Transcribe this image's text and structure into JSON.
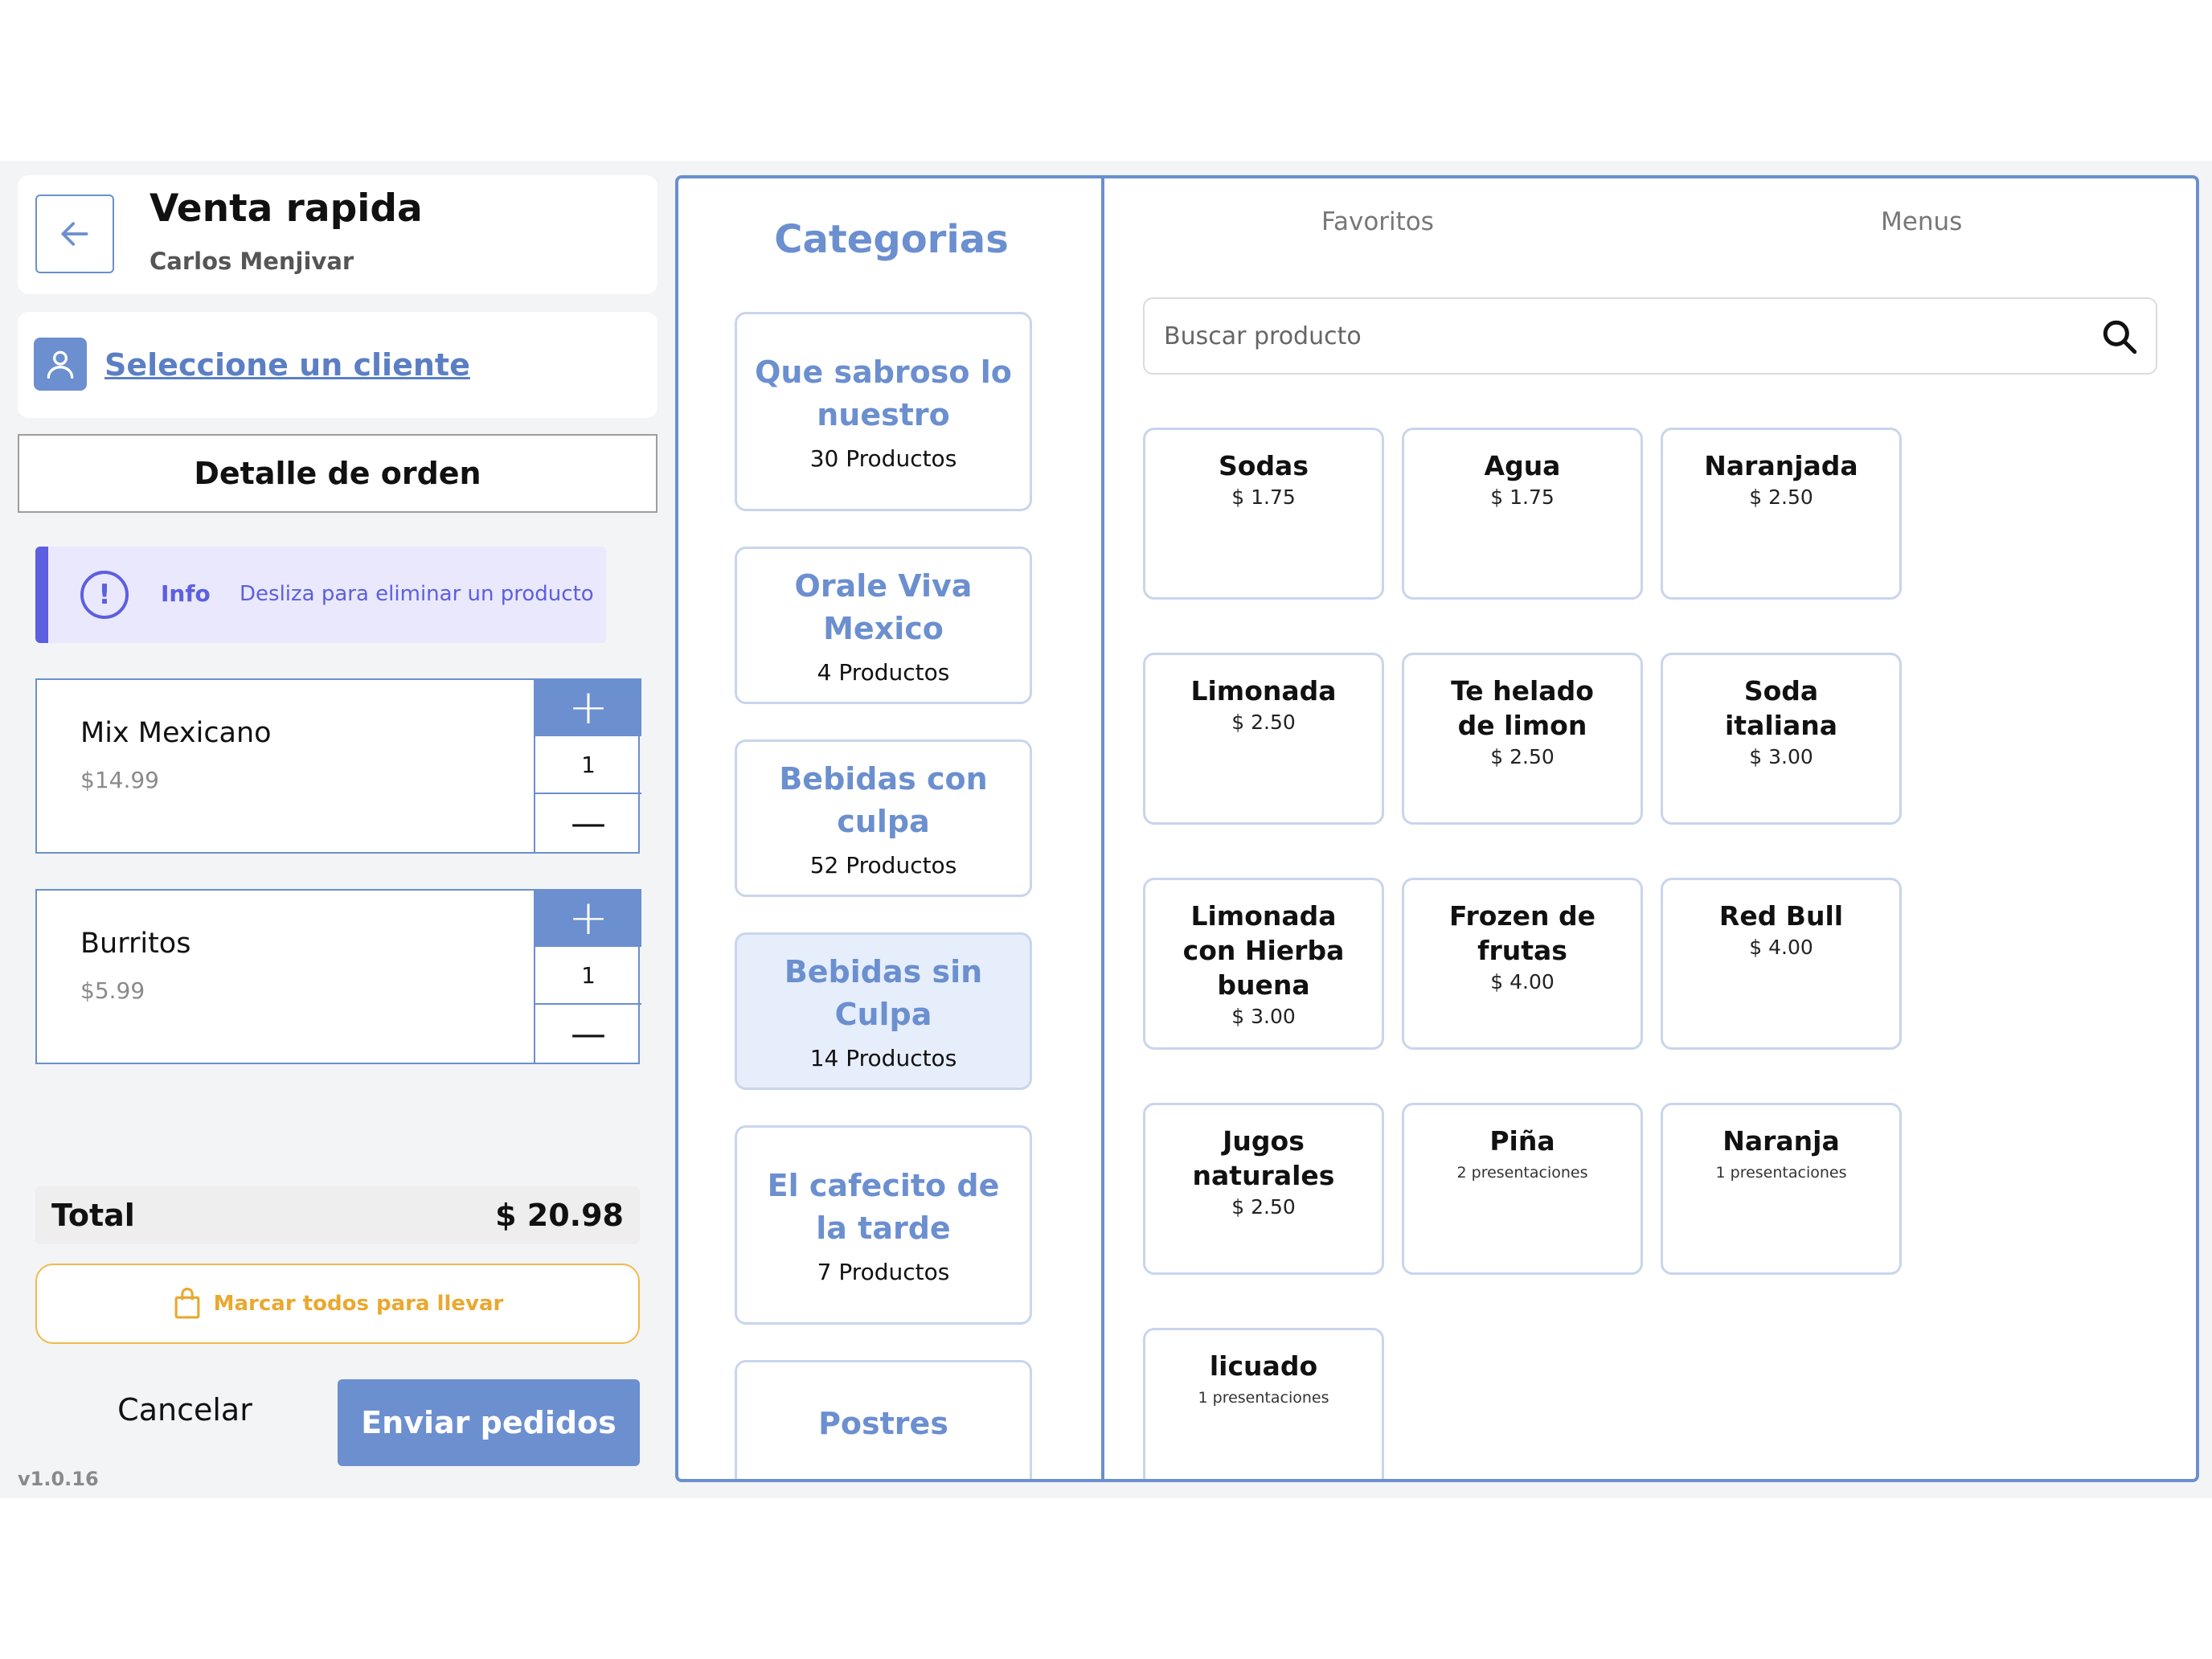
{
  "header": {
    "title": "Venta rapida",
    "user": "Carlos Menjivar"
  },
  "client": {
    "link_label": "Seleccione un cliente"
  },
  "order": {
    "section_title": "Detalle de orden",
    "info_label": "Info",
    "info_text": "Desliza para eliminar un producto",
    "items": [
      {
        "name": "Mix Mexicano",
        "price": "$14.99",
        "qty": "1"
      },
      {
        "name": "Burritos",
        "price": "$5.99",
        "qty": "1"
      }
    ],
    "total_label": "Total",
    "total_value": "$ 20.98",
    "takeaway_label": "Marcar todos para llevar",
    "cancel_label": "Cancelar",
    "send_label": "Enviar pedidos"
  },
  "version": "v1.0.16",
  "categories": {
    "title": "Categorias",
    "items": [
      {
        "name": "Que sabroso lo nuestro",
        "count": "30 Productos"
      },
      {
        "name": "Orale Viva Mexico",
        "count": "4 Productos"
      },
      {
        "name": "Bebidas con culpa",
        "count": "52 Productos"
      },
      {
        "name": "Bebidas sin Culpa",
        "count": "14 Productos"
      },
      {
        "name": "El cafecito de la tarde",
        "count": "7 Productos"
      },
      {
        "name": "Postres",
        "count": ""
      }
    ],
    "selected_index": 3
  },
  "tabs": {
    "favorites": "Favoritos",
    "menus": "Menus"
  },
  "search": {
    "placeholder": "Buscar producto"
  },
  "products": [
    {
      "name": "Sodas",
      "sub": "$ 1.75"
    },
    {
      "name": "Agua",
      "sub": "$ 1.75"
    },
    {
      "name": "Naranjada",
      "sub": "$ 2.50"
    },
    {
      "name": "Limonada",
      "sub": "$ 2.50"
    },
    {
      "name": "Te helado de limon",
      "sub": "$ 2.50"
    },
    {
      "name": "Soda italiana",
      "sub": "$ 3.00"
    },
    {
      "name": "Limonada con Hierba buena",
      "sub": "$ 3.00"
    },
    {
      "name": "Frozen de frutas",
      "sub": "$ 4.00"
    },
    {
      "name": "Red Bull",
      "sub": "$ 4.00"
    },
    {
      "name": "Jugos naturales",
      "sub": "$ 2.50"
    },
    {
      "name": "Piña",
      "sub": "2 presentaciones"
    },
    {
      "name": "Naranja",
      "sub": "1 presentaciones"
    },
    {
      "name": "licuado",
      "sub": "1 presentaciones"
    }
  ],
  "colors": {
    "accent": "#6b8fcf",
    "info": "#5b5fe0",
    "takeaway": "#f0b94d"
  }
}
